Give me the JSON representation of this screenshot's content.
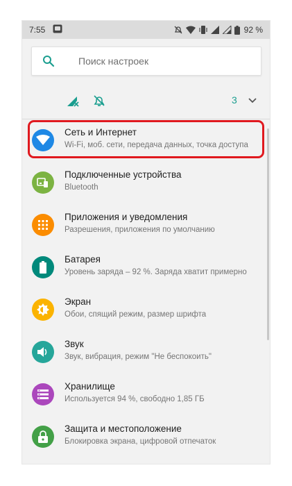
{
  "status_bar": {
    "time": "7:55",
    "battery": "92 %"
  },
  "search": {
    "placeholder": "Поиск настроек"
  },
  "quick_settings": {
    "count": "3"
  },
  "settings": [
    {
      "title": "Сеть и Интернет",
      "subtitle": "Wi-Fi, моб. сети, передача данных, точка доступа",
      "icon": "wifi-icon",
      "color": "#1e88e5"
    },
    {
      "title": "Подключенные устройства",
      "subtitle": "Bluetooth",
      "icon": "devices-icon",
      "color": "#7cb342"
    },
    {
      "title": "Приложения и уведомления",
      "subtitle": "Разрешения, приложения по умолчанию",
      "icon": "apps-icon",
      "color": "#fb8c00"
    },
    {
      "title": "Батарея",
      "subtitle": "Уровень заряда – 92 %. Заряда хватит примерно",
      "icon": "battery-icon",
      "color": "#00897b"
    },
    {
      "title": "Экран",
      "subtitle": "Обои, спящий режим, размер шрифта",
      "icon": "brightness-icon",
      "color": "#fbb300"
    },
    {
      "title": "Звук",
      "subtitle": "Звук, вибрация, режим \"Не беспокоить\"",
      "icon": "volume-icon",
      "color": "#26a69a"
    },
    {
      "title": "Хранилище",
      "subtitle": "Используется 94 %, свободно 1,85 ГБ",
      "icon": "storage-icon",
      "color": "#ab47bc"
    },
    {
      "title": "Защита и местоположение",
      "subtitle": "Блокировка экрана, цифровой отпечаток",
      "icon": "lock-icon",
      "color": "#43a047"
    }
  ],
  "colors": {
    "accent": "#1a9e8f",
    "highlight": "#e0191f"
  }
}
